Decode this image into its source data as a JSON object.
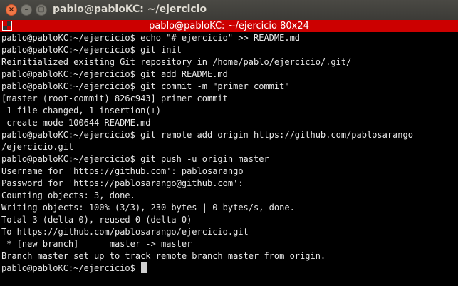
{
  "window": {
    "title": "pablo@pabloKC: ~/ejercicio",
    "tab_title": "pablo@pabloKC: ~/ejercicio 80x24"
  },
  "terminal": {
    "lines": [
      "pablo@pabloKC:~/ejercicio$ echo \"# ejercicio\" >> README.md",
      "pablo@pabloKC:~/ejercicio$ git init",
      "Reinitialized existing Git repository in /home/pablo/ejercicio/.git/",
      "pablo@pabloKC:~/ejercicio$ git add README.md",
      "pablo@pabloKC:~/ejercicio$ git commit -m \"primer commit\"",
      "[master (root-commit) 826c943] primer commit",
      " 1 file changed, 1 insertion(+)",
      " create mode 100644 README.md",
      "pablo@pabloKC:~/ejercicio$ git remote add origin https://github.com/pablosarango",
      "/ejercicio.git",
      "pablo@pabloKC:~/ejercicio$ git push -u origin master",
      "Username for 'https://github.com': pablosarango",
      "Password for 'https://pablosarango@github.com':",
      "Counting objects: 3, done.",
      "Writing objects: 100% (3/3), 230 bytes | 0 bytes/s, done.",
      "Total 3 (delta 0), reused 0 (delta 0)",
      "To https://github.com/pablosarango/ejercicio.git",
      " * [new branch]      master -> master",
      "Branch master set up to track remote branch master from origin."
    ],
    "prompt": "pablo@pabloKC:~/ejercicio$ "
  }
}
